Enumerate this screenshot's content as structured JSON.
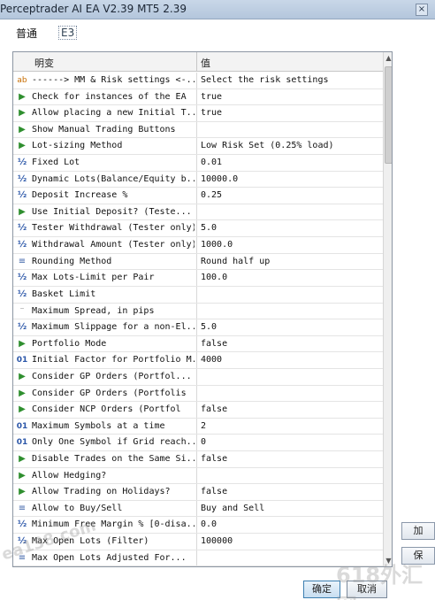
{
  "window": {
    "title": "Perceptrader AI EA V2.39 MT5 2.39",
    "close_label": "×"
  },
  "tabs": [
    {
      "label": "普通"
    },
    {
      "label": "E3"
    }
  ],
  "table": {
    "headers": {
      "name": "明变",
      "value": "值"
    },
    "rows": [
      {
        "icon": "ab-icon",
        "name": "------> MM & Risk settings <-...",
        "value": "Select the risk settings"
      },
      {
        "icon": "flag-icon",
        "name": "Check for instances of the EA",
        "value": "true"
      },
      {
        "icon": "flag-icon",
        "name": "Allow placing a new Initial T...",
        "value": "true"
      },
      {
        "icon": "flag-icon",
        "name": "Show Manual Trading Buttons",
        "value": ""
      },
      {
        "icon": "flag-icon",
        "name": "Lot-sizing Method",
        "value": "Low Risk Set (0.25% load)"
      },
      {
        "icon": "half-icon",
        "name": "Fixed Lot",
        "value": "0.01"
      },
      {
        "icon": "half-icon",
        "name": "Dynamic Lots(Balance/Equity b...",
        "value": "10000.0"
      },
      {
        "icon": "half-icon",
        "name": "Deposit Increase %",
        "value": "0.25"
      },
      {
        "icon": "flag-icon",
        "name": "Use Initial Deposit? (Teste...",
        "value": ""
      },
      {
        "icon": "half-icon",
        "name": "Tester Withdrawal (Tester only)",
        "value": "5.0"
      },
      {
        "icon": "half-icon",
        "name": "Withdrawal Amount (Tester only)",
        "value": "1000.0"
      },
      {
        "icon": "list-icon",
        "name": "Rounding Method",
        "value": "Round half up"
      },
      {
        "icon": "half-icon",
        "name": "Max Lots-Limit per Pair",
        "value": "100.0"
      },
      {
        "icon": "half-icon",
        "name": "Basket Limit",
        "value": ""
      },
      {
        "icon": "dash-icon",
        "name": "Maximum Spread, in pips",
        "value": ""
      },
      {
        "icon": "half-icon",
        "name": "Maximum Slippage for a non-El...",
        "value": "5.0"
      },
      {
        "icon": "flag-icon",
        "name": "Portfolio Mode",
        "value": "false"
      },
      {
        "icon": "01-icon",
        "name": "Initial Factor for Portfolio M...",
        "value": "4000"
      },
      {
        "icon": "flag-icon",
        "name": "Consider GP Orders (Portfol...",
        "value": ""
      },
      {
        "icon": "flag-icon",
        "name": "Consider GP Orders (Portfolis",
        "value": ""
      },
      {
        "icon": "flag-icon",
        "name": "Consider NCP Orders (Portfol",
        "value": "false"
      },
      {
        "icon": "01-icon",
        "name": "Maximum Symbols at a time",
        "value": "2"
      },
      {
        "icon": "01-icon",
        "name": "Only One Symbol if Grid reach...",
        "value": "0"
      },
      {
        "icon": "flag-icon",
        "name": "Disable Trades on the Same Si...",
        "value": "false"
      },
      {
        "icon": "flag-icon",
        "name": "Allow Hedging?",
        "value": ""
      },
      {
        "icon": "flag-icon",
        "name": "Allow Trading on Holidays?",
        "value": "false"
      },
      {
        "icon": "list-icon",
        "name": "Allow to Buy/Sell",
        "value": "Buy and Sell"
      },
      {
        "icon": "half-icon",
        "name": "Minimum Free Margin % [0-disa...",
        "value": "0.0"
      },
      {
        "icon": "half-icon",
        "name": "Max Open Lots (Filter)",
        "value": "100000"
      },
      {
        "icon": "list-icon",
        "name": "Max Open Lots Adjusted For...",
        "value": ""
      }
    ]
  },
  "side_buttons": [
    {
      "label": "加"
    },
    {
      "label": "保"
    }
  ],
  "footer": {
    "ok_label": "确定",
    "cancel_label": "取消"
  },
  "watermarks": [
    "ea138.com",
    "618外汇网"
  ]
}
